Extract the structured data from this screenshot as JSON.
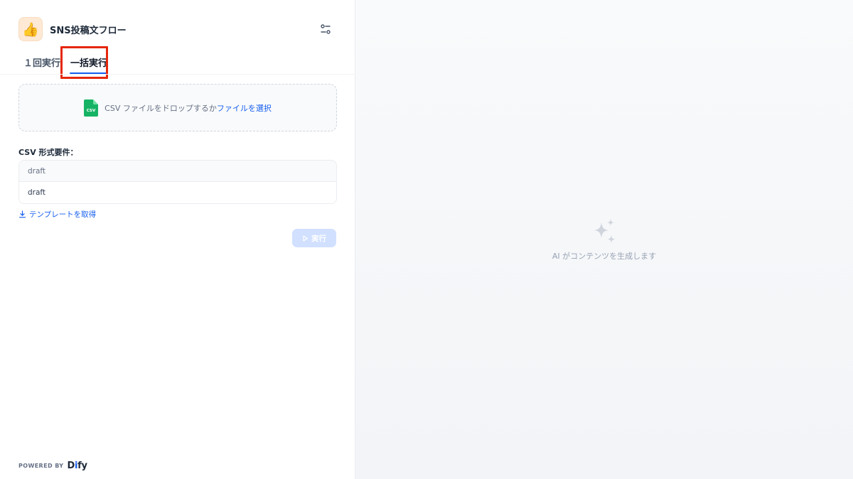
{
  "app": {
    "title": "SNS投稿文フロー",
    "icon": "thumbs-up-emoji",
    "icon_glyph": "👍"
  },
  "tabs": [
    {
      "label": "１回実行",
      "active": false
    },
    {
      "label": "一括実行",
      "active": true
    }
  ],
  "upload": {
    "prompt": "CSV ファイルをドロップするか",
    "link": "ファイルを選択",
    "file_icon_label": "CSV"
  },
  "requirements": {
    "title": "CSV 形式要件：",
    "header": "draft",
    "example": "draft"
  },
  "template_link": "テンプレートを取得",
  "run_button": {
    "label": "実行",
    "enabled": false
  },
  "footer": {
    "powered_by": "POWERED BY",
    "brand_prefix": "D",
    "brand_i": "i",
    "brand_suffix": "fy"
  },
  "output_placeholder": "AI がコンテンツを生成します",
  "colors": {
    "accent": "#155eef",
    "highlight_box": "#e5270b",
    "csv_icon": "#16b364",
    "run_disabled": "#d1e0ff"
  }
}
